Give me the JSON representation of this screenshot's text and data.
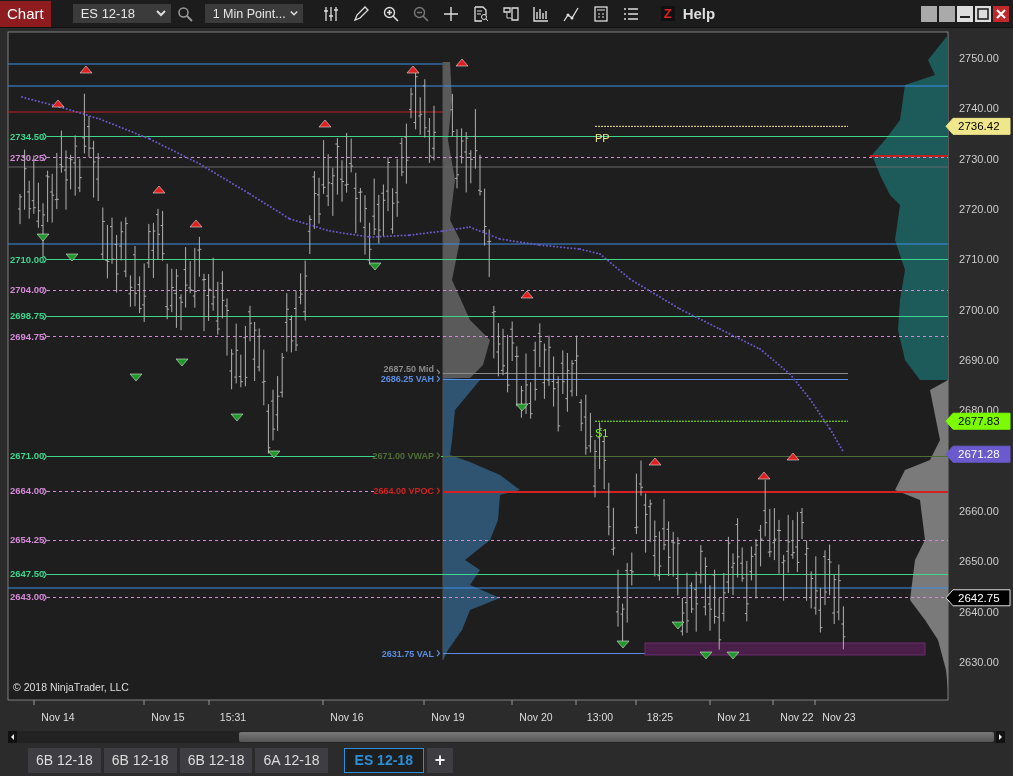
{
  "toolbar": {
    "title": "Chart",
    "instrument": "ES 12-18",
    "interval": "1 Min Point...",
    "z_label": "Z",
    "help": "Help"
  },
  "levels": [
    {
      "label": "2734.50",
      "kind": "solid",
      "color": "#3dd68c"
    },
    {
      "label": "2730.25",
      "kind": "dashed",
      "color": "#d48ad8"
    },
    {
      "label": "2710.00",
      "kind": "solid",
      "color": "#3dd68c"
    },
    {
      "label": "2704.00",
      "kind": "dashed",
      "color": "#d48ad8"
    },
    {
      "label": "2698.75",
      "kind": "solid",
      "color": "#3dd68c"
    },
    {
      "label": "2694.75",
      "kind": "dashed",
      "color": "#d48ad8"
    },
    {
      "label": "2671.00",
      "kind": "solid",
      "color": "#3dd68c"
    },
    {
      "label": "2664.00",
      "kind": "dashed",
      "color": "#d48ad8"
    },
    {
      "label": "2654.25",
      "kind": "dashed",
      "color": "#d48ad8"
    },
    {
      "label": "2647.50",
      "kind": "solid",
      "color": "#3dd68c"
    },
    {
      "label": "2643.00",
      "kind": "dashed",
      "color": "#d48ad8"
    }
  ],
  "profile_labels": [
    {
      "label": "2687.50 Mid",
      "color": "#8a8a8a"
    },
    {
      "label": "2686.25 VAH",
      "color": "#5b8de0"
    },
    {
      "label": "2671.00 VWAP",
      "color": "#4f6e35"
    },
    {
      "label": "2664.00 VPOC",
      "color": "#d42020"
    },
    {
      "label": "2631.75 VAL",
      "color": "#5b8de0"
    }
  ],
  "pivots": [
    {
      "label": "PP",
      "color": "#f0e68c"
    },
    {
      "label": "S1",
      "color": "#7cfc00"
    }
  ],
  "price_axis": [
    "2750.00",
    "2740.00",
    "2730.00",
    "2720.00",
    "2710.00",
    "2700.00",
    "2690.00",
    "2680.00",
    "2660.00",
    "2650.00",
    "2640.00",
    "2630.00"
  ],
  "price_markers": [
    {
      "label": "2736.42",
      "color": "#f0e68c"
    },
    {
      "label": "2677.83",
      "color": "#7cfc00"
    },
    {
      "label": "2671.28",
      "color": "#6a5acd"
    },
    {
      "label": "2642.75",
      "color": "#000000"
    }
  ],
  "copyright": "© 2018 NinjaTrader, LLC",
  "time_axis": [
    "Nov 14",
    "Nov 15",
    "15:31",
    "Nov 16",
    "Nov 19",
    "Nov 20",
    "13:00",
    "18:25",
    "Nov 21",
    "Nov 22",
    "Nov 23"
  ],
  "tabs": [
    {
      "label": "6B 12-18",
      "selected": false
    },
    {
      "label": "6B 12-18",
      "selected": false
    },
    {
      "label": "6B 12-18",
      "selected": false
    },
    {
      "label": "6A 12-18",
      "selected": false
    },
    {
      "label": "ES 12-18",
      "selected": true
    }
  ],
  "add_tab": "+"
}
